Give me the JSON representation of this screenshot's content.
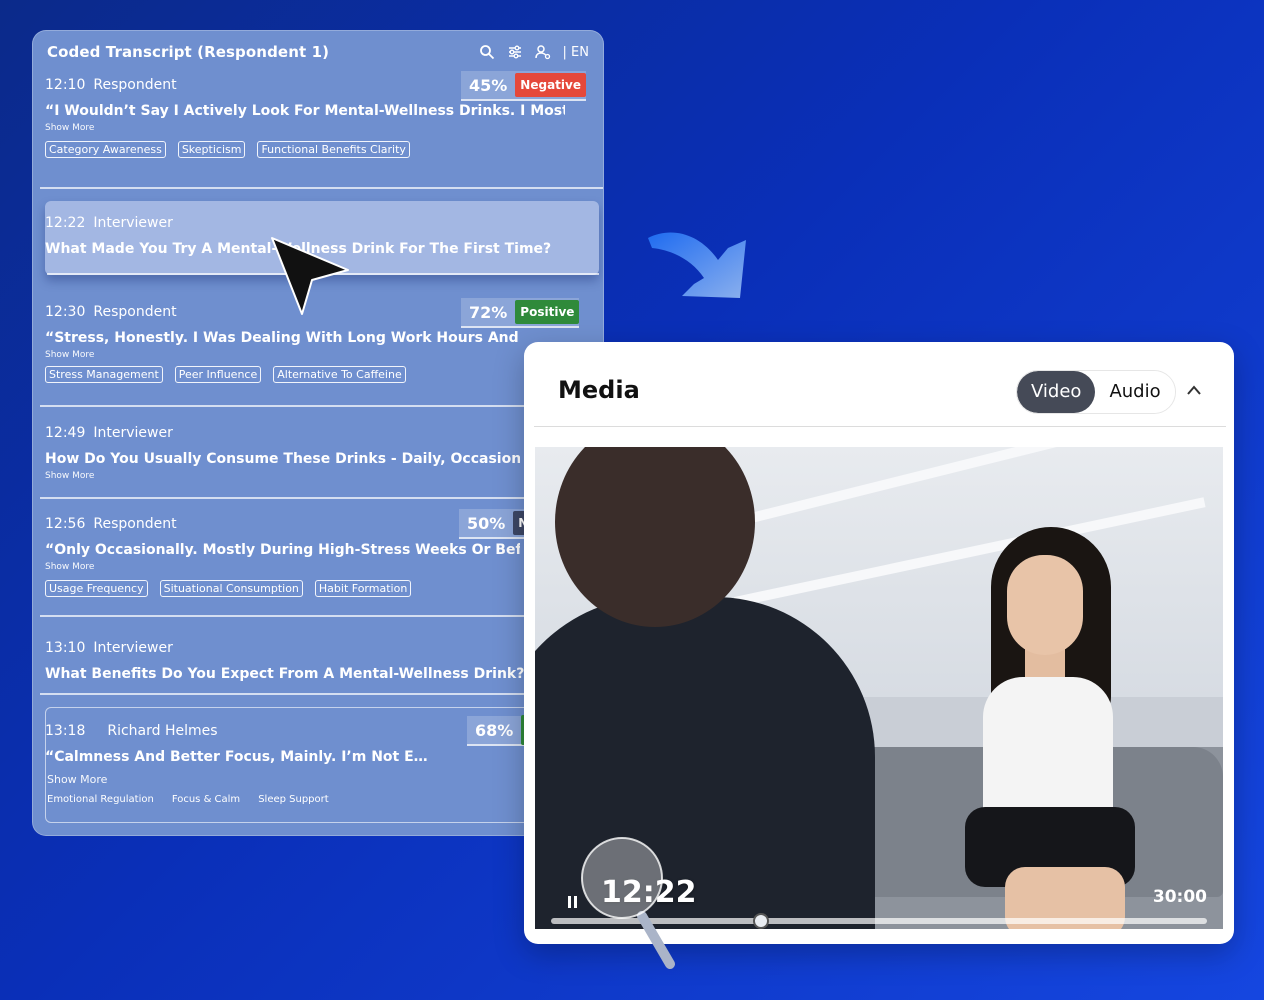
{
  "transcript": {
    "title": "Coded Transcript (Respondent 1)",
    "language": "| EN",
    "entries": [
      {
        "time": "12:10",
        "speaker": "Respondent",
        "score": "45%",
        "sentiment": "Negative",
        "text": "“I Wouldn’t Say I Actively Look For Mental-Wellness Drinks. I Mostly…",
        "more": "Show More",
        "tags": [
          "Category Awareness",
          "Skepticism",
          "Functional Benefits Clarity"
        ]
      },
      {
        "time": "12:22",
        "speaker": "Interviewer",
        "text": "What Made You Try A Mental-Wellness Drink For The First Time?"
      },
      {
        "time": "12:30",
        "speaker": "Respondent",
        "score": "72%",
        "sentiment": "Positive",
        "text": "“Stress, Honestly. I Was Dealing With Long Work Hours And Poor Sl",
        "more": "Show More",
        "tags": [
          "Stress Management",
          "Peer Influence",
          "Alternative To Caffeine"
        ]
      },
      {
        "time": "12:49",
        "speaker": "Interviewer",
        "text": "How Do You Usually Consume These Drinks - Daily, Occasionally",
        "more": "Show More"
      },
      {
        "time": "12:56",
        "speaker": "Respondent",
        "score": "50%",
        "sentiment": "N",
        "text": "“Only Occasionally. Mostly During High-Stress Weeks Or Befo",
        "more": "Show More",
        "tags": [
          "Usage Frequency",
          "Situational Consumption",
          "Habit Formation"
        ]
      },
      {
        "time": "13:10",
        "speaker": "Interviewer",
        "text": "What Benefits Do You Expect From A Mental-Wellness Drink?"
      },
      {
        "time": "13:18",
        "speaker": "Richard Helmes",
        "score": "68%",
        "text": "“Calmness And Better Focus, Mainly. I’m Not E…",
        "more": "Show More",
        "tags": [
          "Emotional Regulation",
          "Focus & Calm",
          "Sleep Support"
        ]
      }
    ]
  },
  "media": {
    "title": "Media",
    "tabs": [
      "Video",
      "Audio"
    ],
    "active_tab": "Video",
    "current_time": "12:22",
    "duration": "30:00",
    "progress": 0.32
  },
  "colors": {
    "negative": "#e5483a",
    "positive": "#2f8a3a",
    "neutral": "#3d4766",
    "accent": "#1546e0"
  },
  "icons": [
    "search-icon",
    "filter-icon",
    "user-settings-icon",
    "chevron-up-icon",
    "pause-icon",
    "cursor-icon",
    "magnifier-icon",
    "arrow-icon"
  ]
}
